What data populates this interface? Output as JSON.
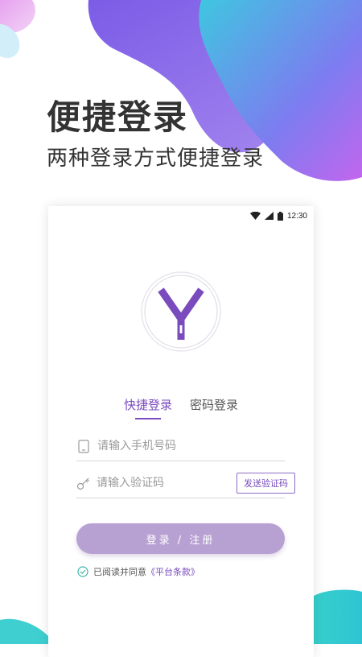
{
  "promo": {
    "title": "便捷登录",
    "subtitle": "两种登录方式便捷登录"
  },
  "status_bar": {
    "time": "12:30",
    "icons": [
      "wifi-icon",
      "signal-icon",
      "battery-icon"
    ]
  },
  "logo": {
    "letter": "Y",
    "color": "#7a4bbd"
  },
  "tabs": [
    {
      "label": "快捷登录",
      "active": true
    },
    {
      "label": "密码登录",
      "active": false
    }
  ],
  "form": {
    "phone_placeholder": "请输入手机号码",
    "code_placeholder": "请输入验证码",
    "send_code_label": "发送验证码",
    "submit_label": "登录 / 注册"
  },
  "agreement": {
    "prefix": "已阅读并同意",
    "terms": "《平台条款》"
  },
  "colors": {
    "accent": "#7a4bbd",
    "button": "#b7a0d2",
    "check": "#3bb6a8"
  }
}
